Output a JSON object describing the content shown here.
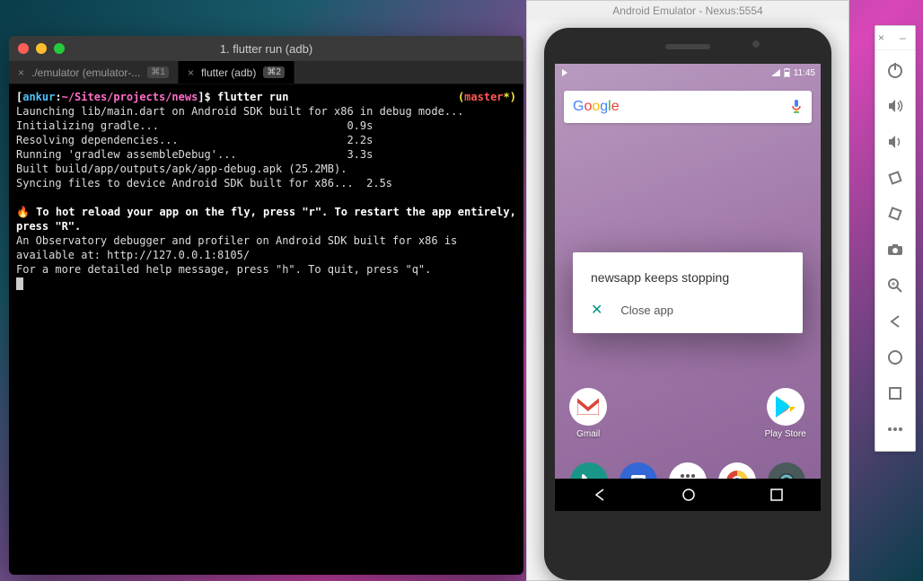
{
  "terminal": {
    "title": "1. flutter run (adb)",
    "tabs": [
      {
        "label": "./emulator (emulator-...",
        "shortcut": "⌘1",
        "active": false
      },
      {
        "label": "flutter (adb)",
        "shortcut": "⌘2",
        "active": true
      }
    ],
    "prompt_open": "[",
    "prompt_user": "ankur",
    "prompt_sep": ":",
    "prompt_path": "~/Sites/projects/news",
    "prompt_close": "]$",
    "command": "flutter run",
    "git_open": "(",
    "git_branch": "master",
    "git_star": "*",
    "git_close": ")",
    "lines": [
      "",
      "Launching lib/main.dart on Android SDK built for x86 in debug mode...",
      "Initializing gradle...                             0.9s",
      "Resolving dependencies...                          2.2s",
      "Running 'gradlew assembleDebug'...                 3.3s",
      "Built build/app/outputs/apk/app-debug.apk (25.2MB).",
      "Syncing files to device Android SDK built for x86...  2.5s",
      ""
    ],
    "hot_reload_prefix": "🔥 ",
    "hot_reload_bold": "To hot reload your app on the fly, press \"r\". To restart the app entirely, press \"R\".",
    "observatory": "An Observatory debugger and profiler on Android SDK built for x86 is available at: http://127.0.0.1:8105/",
    "help": "For a more detailed help message, press \"h\". To quit, press \"q\"."
  },
  "emulator": {
    "title": "Android Emulator - Nexus:5554",
    "status_time": "11:45",
    "search_placeholder": "Google",
    "dialog_title": "newsapp keeps stopping",
    "dialog_action": "Close app",
    "apps_row1": [
      {
        "name": "gmail",
        "label": "Gmail"
      },
      {
        "name": "play-store",
        "label": "Play Store"
      }
    ],
    "apps_row2": [
      {
        "name": "phone"
      },
      {
        "name": "messages"
      },
      {
        "name": "apps"
      },
      {
        "name": "chrome"
      },
      {
        "name": "camera"
      }
    ]
  },
  "sidebar": {
    "buttons": [
      "power",
      "volume-up",
      "volume-down",
      "rotate-left",
      "rotate-right",
      "camera",
      "zoom",
      "back",
      "home",
      "overview",
      "more"
    ]
  }
}
